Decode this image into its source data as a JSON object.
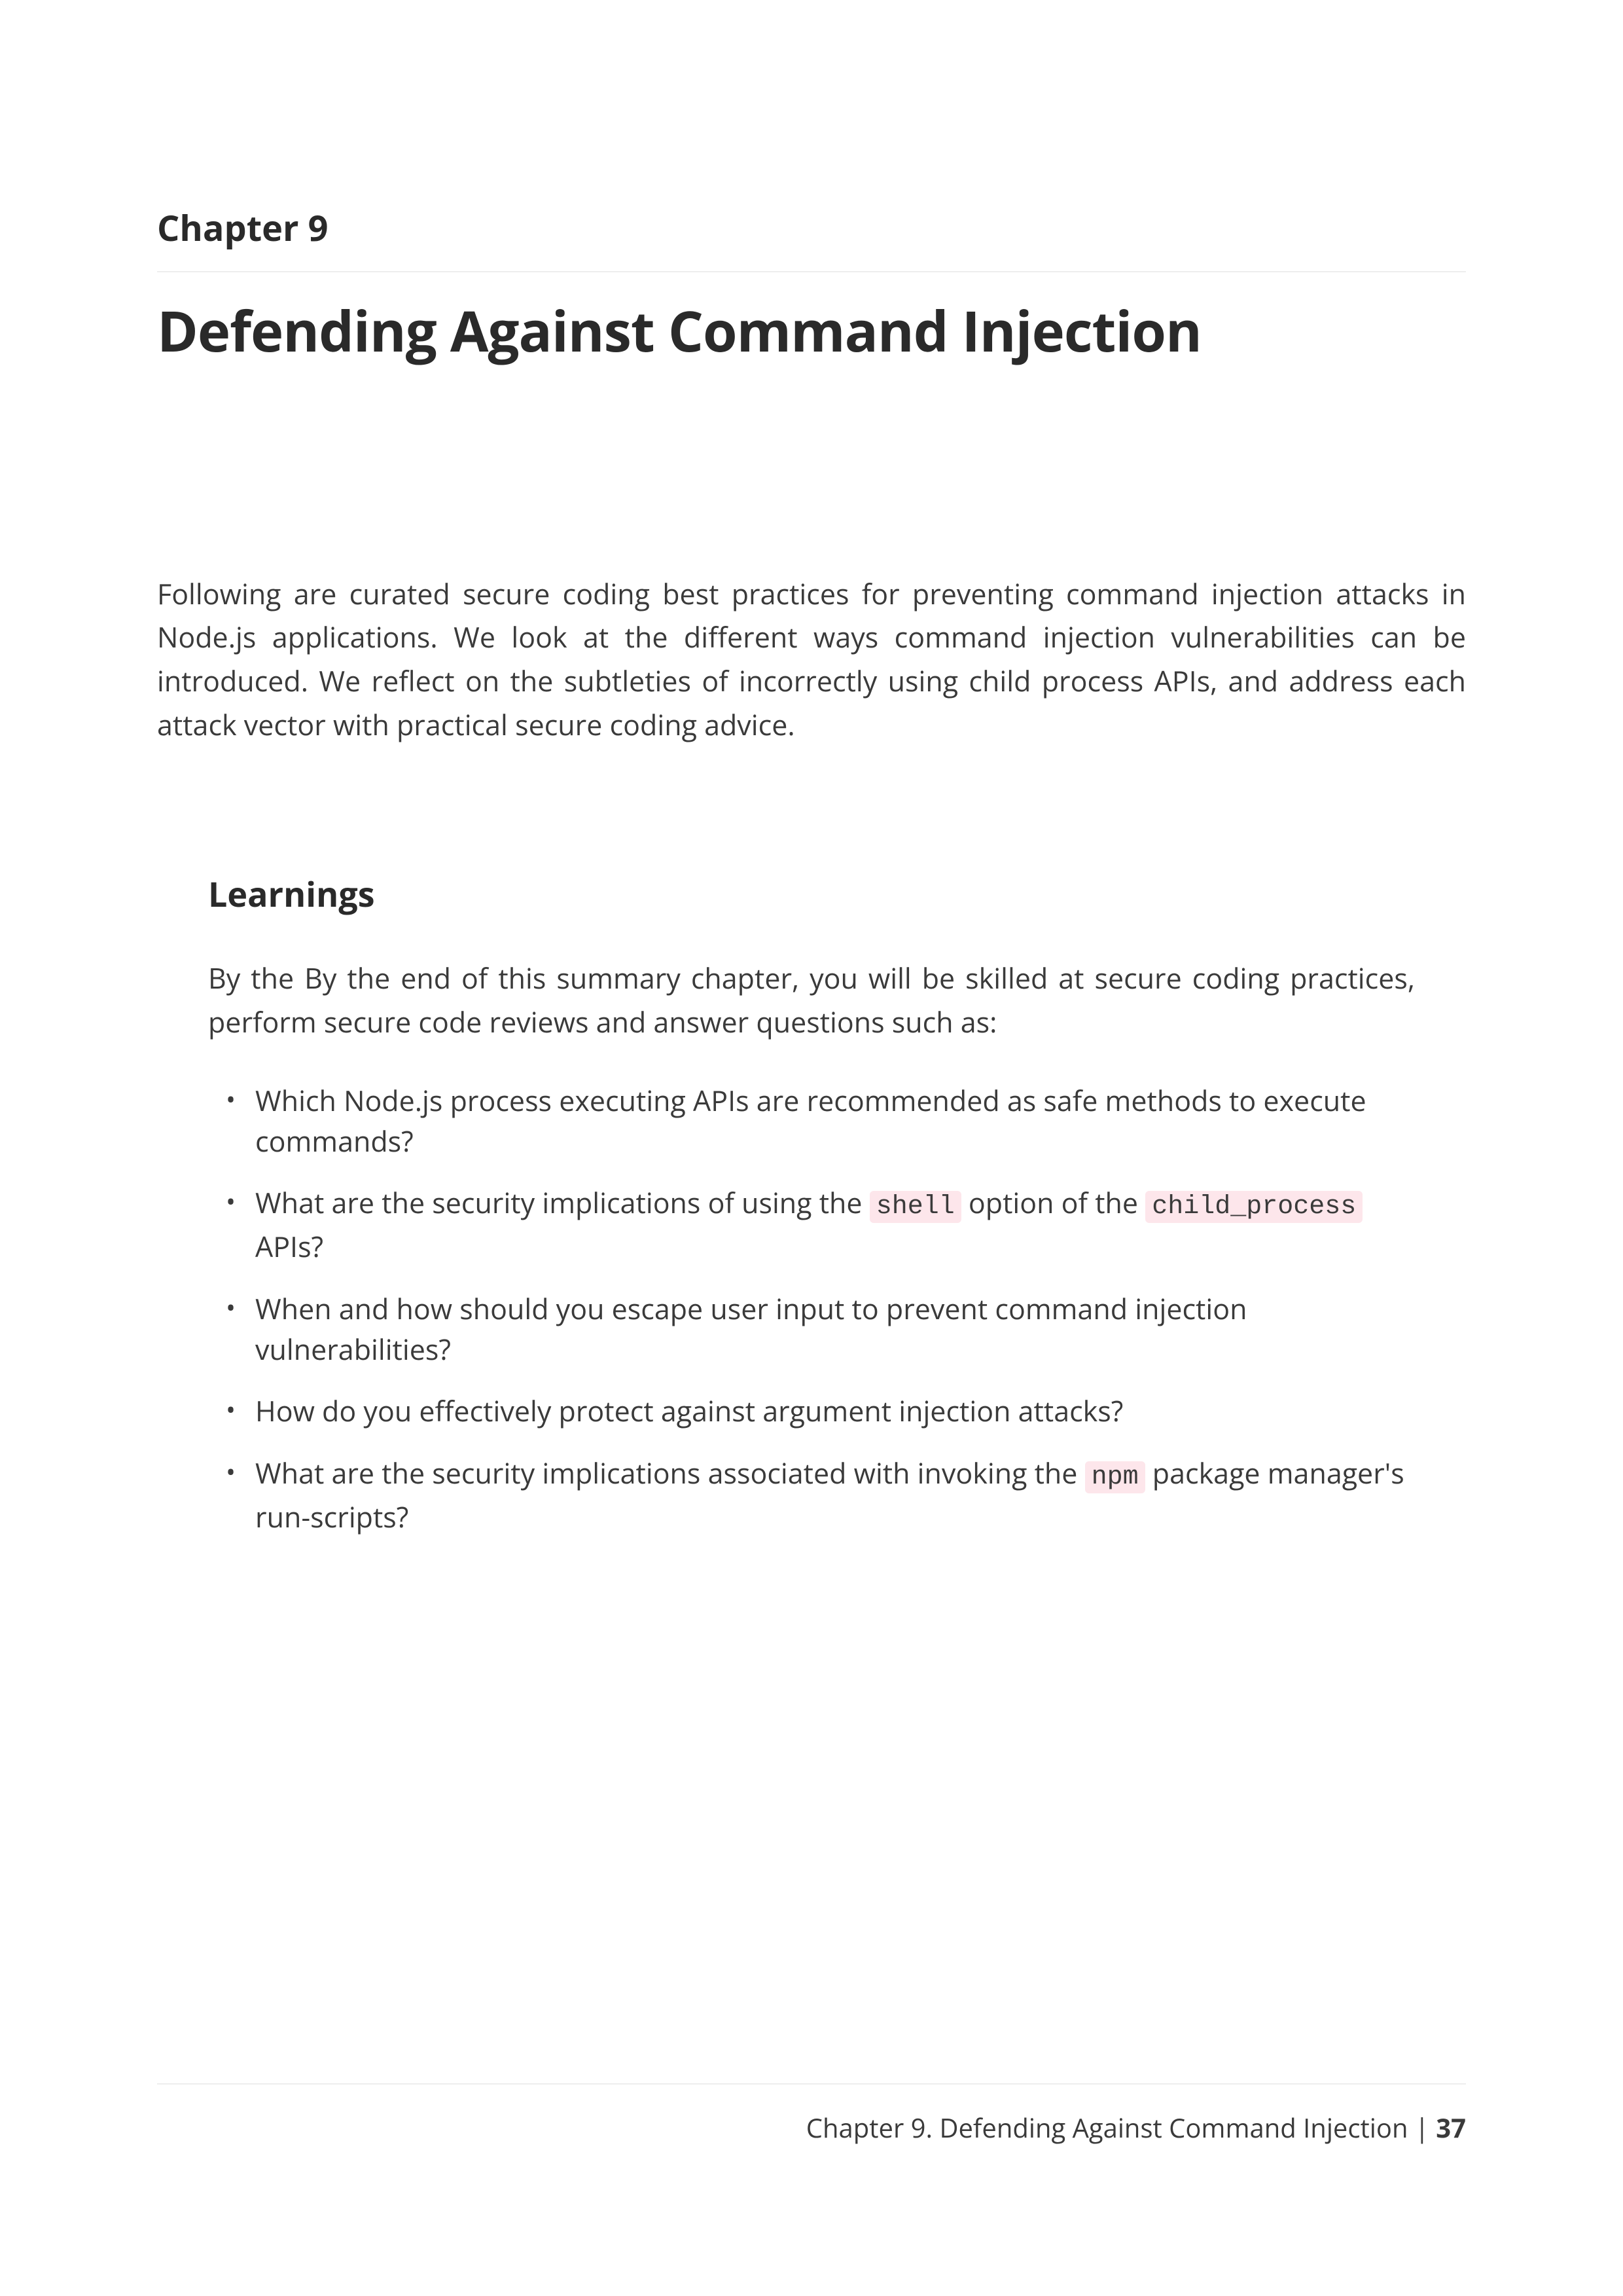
{
  "chapter": {
    "label": "Chapter 9",
    "title": "Defending Against Command Injection"
  },
  "intro": "Following are curated secure coding best practices for preventing command injection attacks in Node.js applications. We look at the different ways command injection vulnerabilities can be introduced. We reflect on the subtleties of incorrectly using child process APIs, and address each attack vector with practical secure coding advice.",
  "learnings": {
    "heading": "Learnings",
    "intro": "By the By the end of this summary chapter, you will be skilled at secure coding practices, perform secure code reviews and answer questions such as:",
    "items": [
      {
        "segments": [
          {
            "type": "text",
            "value": "Which Node.js process executing APIs are recommended as safe methods to execute commands?"
          }
        ]
      },
      {
        "segments": [
          {
            "type": "text",
            "value": "What are the security implications of using the "
          },
          {
            "type": "code",
            "value": "shell"
          },
          {
            "type": "text",
            "value": " option of the "
          },
          {
            "type": "code",
            "value": "child_process"
          },
          {
            "type": "text",
            "value": " APIs?"
          }
        ]
      },
      {
        "segments": [
          {
            "type": "text",
            "value": "When and how should you escape user input to prevent command injection vulnerabilities?"
          }
        ]
      },
      {
        "segments": [
          {
            "type": "text",
            "value": "How do you effectively protect against argument injection attacks?"
          }
        ]
      },
      {
        "segments": [
          {
            "type": "text",
            "value": "What are the security implications associated with invoking the "
          },
          {
            "type": "code",
            "value": "npm"
          },
          {
            "type": "text",
            "value": " package manager's run-scripts?"
          }
        ]
      }
    ]
  },
  "footer": {
    "text": "Chapter 9. Defending Against Command Injection",
    "separator": " | ",
    "page": "37"
  }
}
